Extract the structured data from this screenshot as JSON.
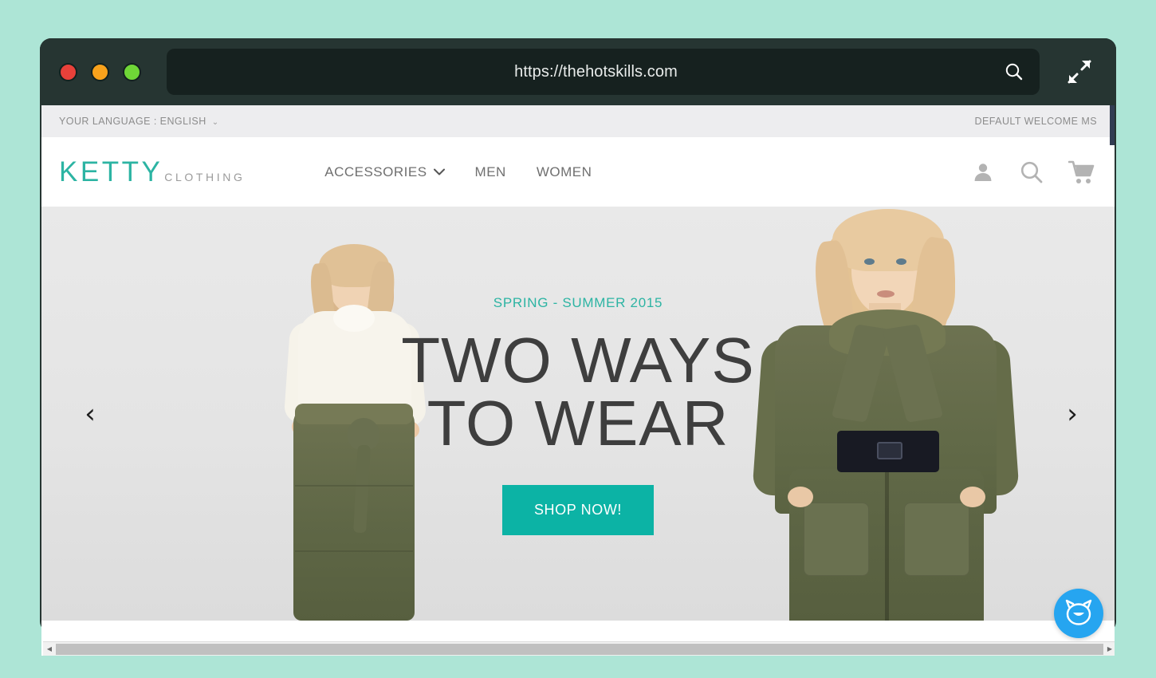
{
  "browser": {
    "url": "https://thehotskills.com",
    "search_icon": "search-icon",
    "expand_icon": "expand-icon",
    "traffic_lights": [
      "close-red",
      "minimize-amber",
      "maximize-green"
    ]
  },
  "topbar": {
    "language_label": "YOUR LANGUAGE : ENGLISH",
    "language_chevron": "⌄",
    "welcome_message": "DEFAULT WELCOME MS",
    "dropdown_icon": "▼"
  },
  "header": {
    "logo_main": "KETTY",
    "logo_sub": "CLOTHING",
    "nav": [
      {
        "label": "ACCESSORIES",
        "has_dropdown": true,
        "chevron": "⌄"
      },
      {
        "label": "MEN",
        "has_dropdown": false
      },
      {
        "label": "WOMEN",
        "has_dropdown": false
      }
    ],
    "icons": [
      "account-icon",
      "search-icon",
      "cart-icon"
    ]
  },
  "hero": {
    "eyebrow": "SPRING - SUMMER 2015",
    "title_line1": "TWO WAYS",
    "title_line2": "TO WEAR",
    "cta_label": "SHOP NOW!",
    "prev_arrow": "‹",
    "next_arrow": "›"
  },
  "chat": {
    "icon": "chat-mascot-icon"
  },
  "scrollbar": {
    "left_arrow": "◀",
    "right_arrow": "▶"
  },
  "colors": {
    "accent_teal": "#0cb3a5",
    "logo_teal": "#2cb4a3",
    "page_background": "#ade5d6",
    "browser_chrome": "#263532",
    "topbar_background": "#ededef",
    "dropdown_navy": "#323d53",
    "chat_blue": "#26a5f0",
    "hero_background": "#e6e6e6",
    "title_gray": "#3e3e3e"
  }
}
